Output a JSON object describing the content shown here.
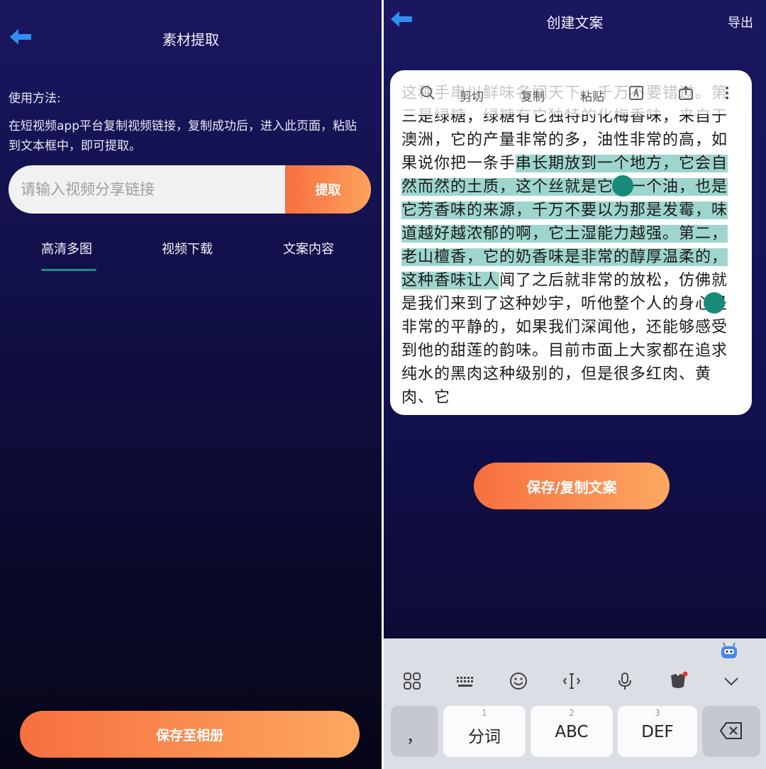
{
  "left_screen": {
    "title": "素材提取",
    "usage_heading": "使用方法:",
    "usage_body": "在短视频app平台复制视频链接，复制成功后，进入此页面，粘贴到文本框中，即可提取。",
    "link_input": {
      "placeholder": "请输入视频分享链接",
      "value": ""
    },
    "extract_button": "提取",
    "tabs": [
      {
        "label": "高清多图",
        "active": true
      },
      {
        "label": "视频下载",
        "active": false
      },
      {
        "label": "文案内容",
        "active": false
      }
    ],
    "save_button": "保存至相册"
  },
  "right_screen": {
    "title": "创建文案",
    "export_label": "导出",
    "text_before_selection": "这种手串以鲜味名闻天下，千万不要错过。第三是绿糖，绿糖有它独特的化梅香味，来自于澳洲，它的产量非常的多，油性非常的高，如果说你把一条手",
    "text_selected": "串长期放到一个地方，它会自然而然的土质，这个丝就是它的一个油，也是它芳香味的来源，千万不要以为那是发霉，味道越好越浓郁的啊，它土湿能力越强。第二，老山檀香，它的奶香味是非常的醇厚温柔的，这种香味让人",
    "text_after_selection": "闻了之后就非常的放松，仿佛就是我们来到了这种妙宇，听他整个人的身心是非常的平静的，如果我们深闻他，还能够感受到他的甜莲的韵味。目前市面上大家都在追求纯水的黑肉这种级别的，但是很多红肉、黄肉、它",
    "selection_toolbar": {
      "items": [
        "剪切",
        "复制",
        "粘贴"
      ],
      "icons": [
        "search-icon",
        "translate-icon",
        "share-icon",
        "more-icon"
      ]
    },
    "save_copy_button": "保存/复制文案",
    "keyboard": {
      "toolbar_icons": [
        "apps-icon",
        "keyboard-icon",
        "emoji-icon",
        "cursor-icon",
        "microphone-icon",
        "skin-icon",
        "collapse-icon"
      ],
      "keys": [
        {
          "label": "，",
          "number": ""
        },
        {
          "label": "分词",
          "number": "1"
        },
        {
          "label": "ABC",
          "number": "2"
        },
        {
          "label": "DEF",
          "number": "3"
        }
      ],
      "delete_icon": "backspace-icon"
    }
  },
  "colors": {
    "background_dark": "#12104a",
    "accent_orange_start": "#f86f3f",
    "accent_orange_end": "#fca860",
    "tab_underline": "#1f8f80",
    "selection_highlight": "#9ed6cd",
    "selection_handle": "#188a78",
    "back_arrow": "#2f8ff2"
  }
}
